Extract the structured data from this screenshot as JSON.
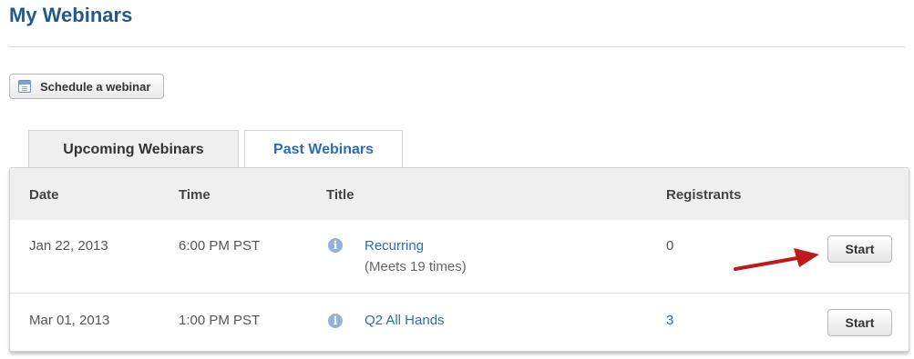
{
  "page": {
    "title": "My Webinars"
  },
  "toolbar": {
    "schedule_label": "Schedule a webinar",
    "schedule_icon": "calendar-icon"
  },
  "tabs": [
    {
      "label": "Upcoming Webinars",
      "active": true
    },
    {
      "label": "Past Webinars",
      "active": false
    }
  ],
  "table": {
    "columns": [
      "Date",
      "Time",
      "Title",
      "Registrants"
    ],
    "rows": [
      {
        "date": "Jan 22, 2013",
        "time": "6:00 PM PST",
        "title": "Recurring",
        "subtitle": "(Meets 19 times)",
        "registrants": "0",
        "action": "Start"
      },
      {
        "date": "Mar 01, 2013",
        "time": "1:00 PM PST",
        "title": "Q2 All Hands",
        "subtitle": "",
        "registrants": "3",
        "action": "Start"
      }
    ]
  },
  "colors": {
    "title": "#1f5a8b",
    "link": "#2a6db5",
    "arrow": "#c0191c",
    "info_icon": "#8fb3db"
  },
  "icons": {
    "info": "info-icon",
    "annotation": "red-arrow"
  }
}
